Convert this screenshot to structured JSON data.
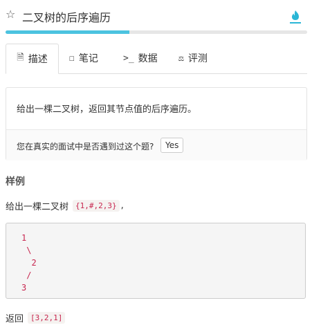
{
  "header": {
    "title": "二叉树的后序遍历",
    "star_icon": "star-outline-icon",
    "flame_icon": "flame-icon",
    "accent_color": "#4cc3e0"
  },
  "progress": {
    "fraction": 0.41
  },
  "tabs": [
    {
      "label": "描述",
      "icon": "document-icon",
      "active": true
    },
    {
      "label": "笔记",
      "icon": "note-icon",
      "active": false
    },
    {
      "label": "数据",
      "icon": "terminal-icon",
      "active": false
    },
    {
      "label": "评测",
      "icon": "scale-icon",
      "active": false
    }
  ],
  "problem": {
    "description": "给出一棵二叉树，返回其节点值的后序遍历。",
    "interview_question": "您在真实的面试中是否遇到过这个题?",
    "yes_label": "Yes"
  },
  "example": {
    "heading": "样例",
    "intro": "给出一棵二叉树",
    "input_code": "{1,#,2,3}",
    "intro_tail": ",",
    "tree_diagram": "1\n \\\n  2\n /\n3",
    "return_label": "返回",
    "output_code": "[3,2,1]"
  }
}
